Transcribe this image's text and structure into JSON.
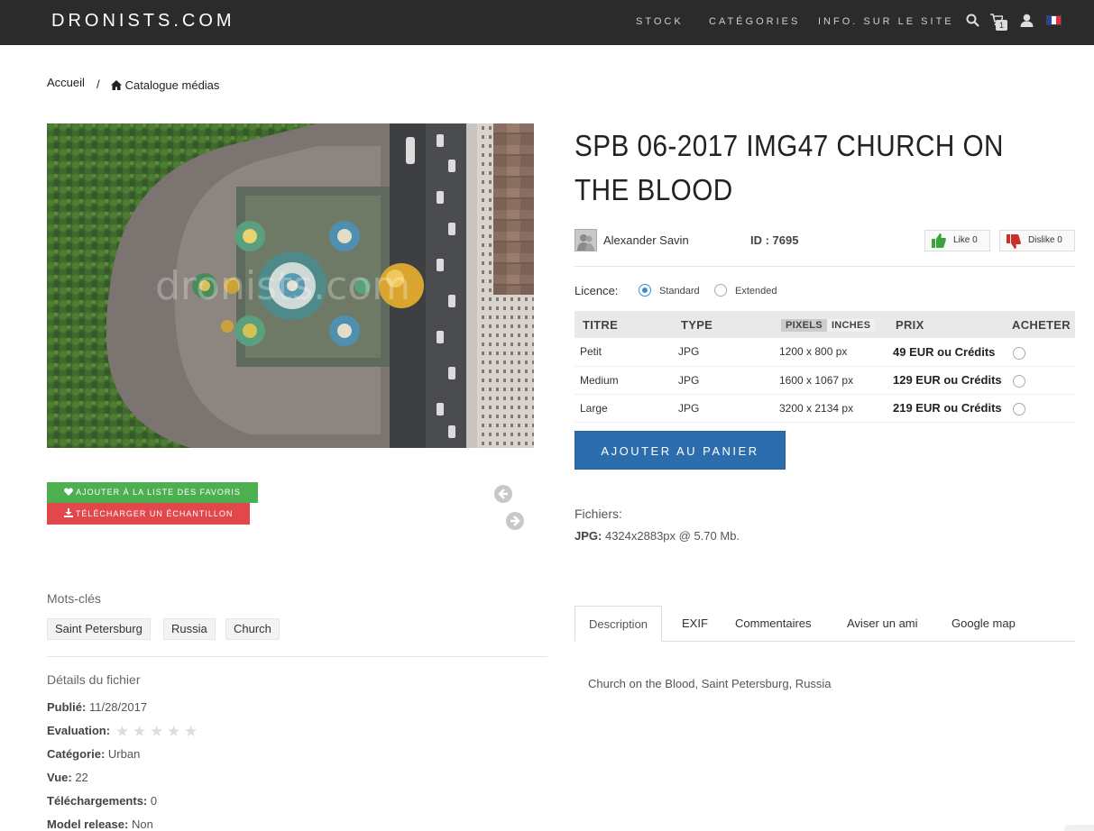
{
  "header": {
    "logo": "DRONISTS.COM",
    "nav": [
      "STOCK",
      "CATÉGORIES",
      "INFO. SUR LE SITE"
    ],
    "cart_count": "1",
    "icons": [
      "search-icon",
      "cart-icon",
      "user-icon",
      "flag-fr-icon"
    ]
  },
  "breadcrumb": {
    "home": "Accueil",
    "separator": "/",
    "current": "Catalogue médias"
  },
  "photo": {
    "watermark": "dronists.com",
    "subject": "aerial view of Church on the Blood"
  },
  "item": {
    "title": "SPB 06-2017 IMG47 CHURCH ON THE BLOOD",
    "author": "Alexander Savin",
    "id_label": "ID : 7695",
    "like_label": "Like 0",
    "dislike_label": "Dislike 0"
  },
  "licence": {
    "label": "Licence:",
    "options": [
      "Standard",
      "Extended"
    ],
    "selected": "Standard"
  },
  "price_table": {
    "headers": [
      "TITRE",
      "TYPE",
      "PIXELS",
      "INCHES",
      "PRIX",
      "ACHETER"
    ],
    "rows": [
      {
        "title": "Petit",
        "type": "JPG",
        "size": "1200 x 800 px",
        "price": "49 EUR ou Crédits"
      },
      {
        "title": "Medium",
        "type": "JPG",
        "size": "1600 x 1067 px",
        "price": "129 EUR ou Crédits"
      },
      {
        "title": "Large",
        "type": "JPG",
        "size": "3200 x 2134 px",
        "price": "219 EUR ou Crédits"
      }
    ]
  },
  "actions": {
    "add_to_cart": "AJOUTER AU PANIER",
    "favorites": "AJOUTER À LA LISTE DES FAVORIS",
    "download_sample": "TÉLÉCHARGER UN ÉCHANTILLON"
  },
  "files": {
    "label": "Fichiers:",
    "format": "JPG:",
    "value": "4324x2883px @ 5.70 Mb."
  },
  "keywords": {
    "title": "Mots-clés",
    "items": [
      "Saint Petersburg",
      "Russia",
      "Church"
    ]
  },
  "details": {
    "title": "Détails du fichier",
    "published_label": "Publié:",
    "published": "11/28/2017",
    "rating_label": "Evaluation:",
    "rating": 0,
    "rating_max": 5,
    "category_label": "Catégorie:",
    "category": "Urban",
    "views_label": "Vue:",
    "views": "22",
    "downloads_label": "Téléchargements:",
    "downloads": "0",
    "model_release_label": "Model release:",
    "model_release": "Non"
  },
  "tabs": {
    "items": [
      "Description",
      "EXIF",
      "Commentaires",
      "Aviser un ami",
      "Google map"
    ],
    "active": "Description",
    "description_text": "Church on the Blood, Saint Petersburg, Russia"
  },
  "colors": {
    "navbar": "#2b2b2b",
    "primary_button": "#2c6ead",
    "favorites_button": "#4caf50",
    "download_button": "#e2474b"
  }
}
